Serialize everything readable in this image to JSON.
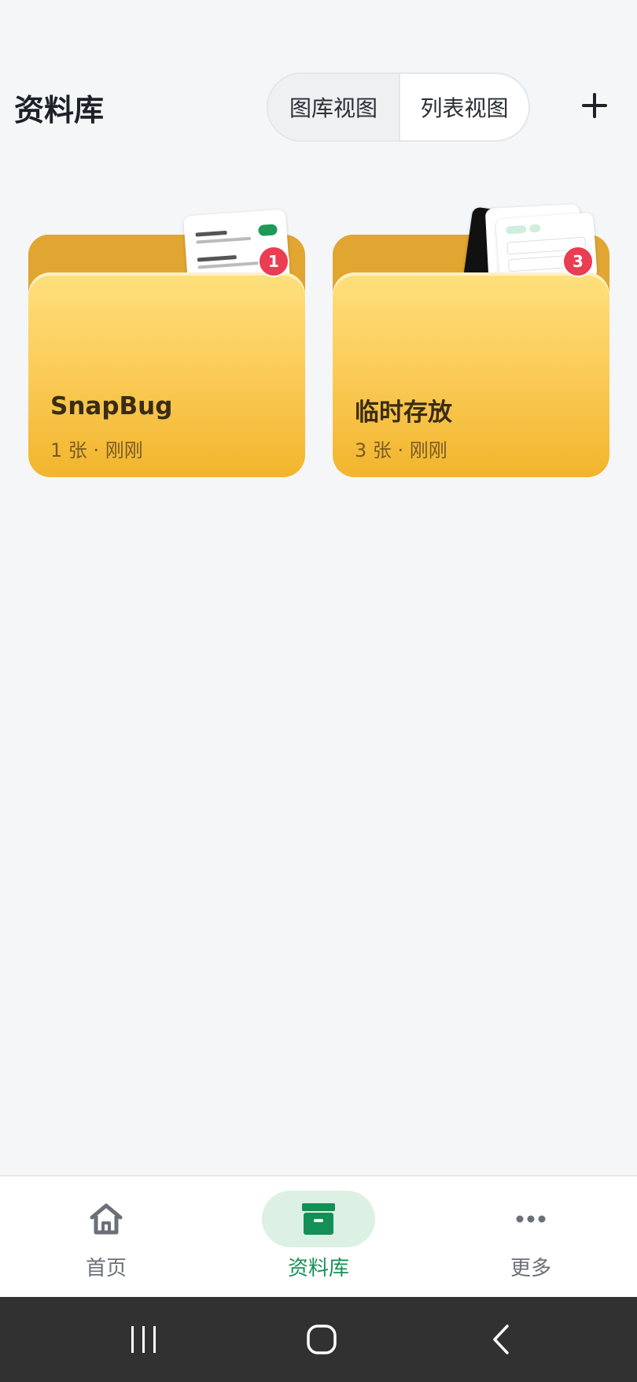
{
  "header": {
    "title": "资料库",
    "view_toggle": {
      "gallery_label": "图库视图",
      "list_label": "列表视图",
      "active": "gallery"
    },
    "add_icon": "plus-icon"
  },
  "folders": [
    {
      "name": "SnapBug",
      "meta": "1 张 · 刚刚",
      "badge": "1"
    },
    {
      "name": "临时存放",
      "meta": "3 张 · 刚刚",
      "badge": "3"
    }
  ],
  "tabbar": {
    "items": [
      {
        "label": "首页",
        "icon": "home-icon",
        "active": false
      },
      {
        "label": "资料库",
        "icon": "archive-icon",
        "active": true
      },
      {
        "label": "更多",
        "icon": "more-dots-icon",
        "active": false
      }
    ],
    "active_color": "#149056"
  },
  "system_nav": {
    "icons": [
      "recent-apps-icon",
      "home-button-icon",
      "back-icon"
    ]
  },
  "colors": {
    "folder_front": "#f8c548",
    "folder_back": "#e1a532",
    "badge": "#ea3d52",
    "accent": "#149056"
  }
}
